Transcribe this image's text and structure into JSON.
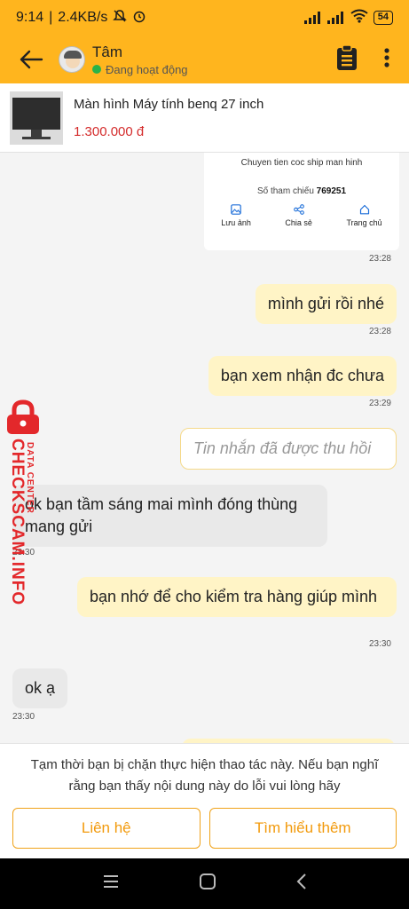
{
  "status_bar": {
    "time": "9:14",
    "speed": "2.4KB/s",
    "battery": "54"
  },
  "header": {
    "name": "Tâm",
    "status": "Đang hoạt động"
  },
  "product": {
    "title": "Màn hình Máy tính benq 27 inch",
    "price": "1.300.000 đ"
  },
  "transfer_card": {
    "title": "Chuyen tien coc ship man hinh",
    "ref_label": "Số tham chiếu",
    "ref_number": "769251",
    "actions": [
      {
        "label": "Lưu ảnh",
        "icon": "image-icon"
      },
      {
        "label": "Chia sẻ",
        "icon": "share-icon"
      },
      {
        "label": "Trang chủ",
        "icon": "home-icon"
      }
    ],
    "time": "23:28"
  },
  "messages": [
    {
      "from": "me",
      "text": "mình gửi rồi nhé",
      "time": "23:28"
    },
    {
      "from": "me",
      "text": "bạn xem nhận đc chưa",
      "time": "23:29"
    },
    {
      "from": "me",
      "text": "Tin nhắn đã được thu hồi",
      "recalled": true
    },
    {
      "from": "them",
      "text": "ok bạn tầm sáng mai mình đóng thùng mang gửi",
      "time": "23:30"
    },
    {
      "from": "me",
      "text": "bạn nhớ để cho kiểm tra hàng giúp mình",
      "time": "23:30"
    },
    {
      "from": "them",
      "text": "ok ạ",
      "time": "23:30"
    }
  ],
  "watermark": {
    "brand": "CHECKSCAM.INFO",
    "sub": "DATA CENTER"
  },
  "blocked": {
    "message": "Tạm thời bạn bị chặn thực hiện thao tác này. Nếu bạn nghĩ rằng bạn thấy nội dung này do lỗi vui lòng hãy",
    "contact_label": "Liên hệ",
    "learn_more_label": "Tìm hiểu thêm"
  },
  "colors": {
    "brand": "#ffb51e",
    "price": "#d42b2b",
    "mine_bubble": "#fff4c6",
    "online": "#29b34a"
  }
}
